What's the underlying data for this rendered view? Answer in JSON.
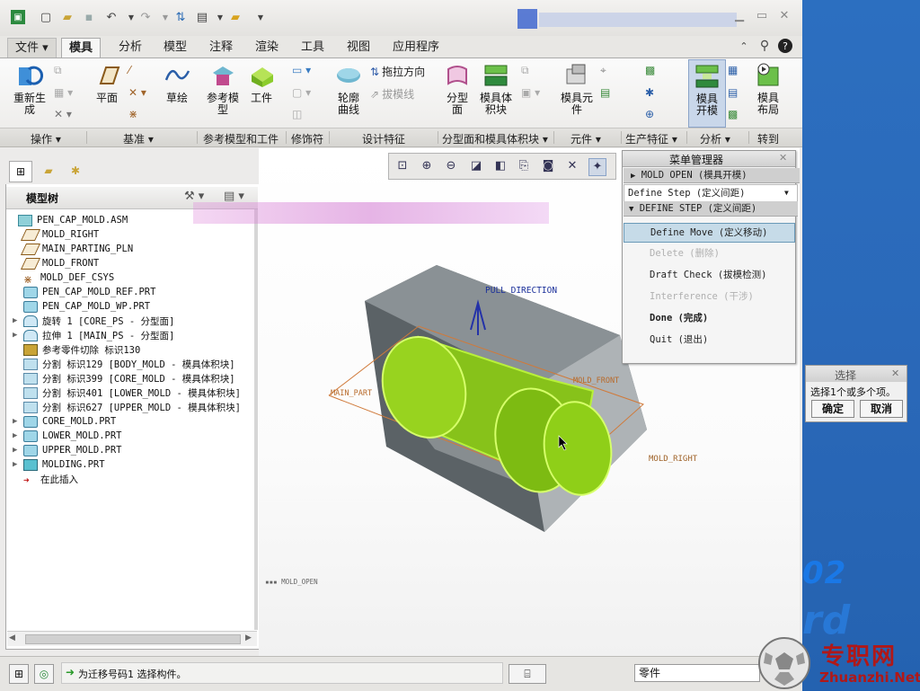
{
  "colors": {
    "accent": "#9bd70f",
    "desktop": "#2a68b8",
    "tab_active_bg": "#f6f6f5"
  },
  "ribbon_tabs": [
    "文件",
    "模具",
    "分析",
    "模型",
    "注释",
    "渲染",
    "工具",
    "视图",
    "应用程序"
  ],
  "ribbon": {
    "regenerate": "重新生\n成",
    "plane": "平面",
    "sketch": "草绘",
    "ref_model": "参考模\n型",
    "workpiece": "工件",
    "profile_curve": "轮廓\n曲线",
    "drag_direction": "拖拉方向",
    "draft_line": "拔模线",
    "parting_surface": "分型\n面",
    "mold_volume": "模具体\n积块",
    "mold_component": "模具元\n件",
    "mold_open": "模具\n开模",
    "mold_layout": "模具\n布局"
  },
  "groups": [
    "操作",
    "基准",
    "参考模型和工件",
    "修饰符",
    "设计特征",
    "分型面和模具体积块",
    "元件",
    "生产特征",
    "分析",
    "转到"
  ],
  "tree": {
    "title": "模型树",
    "items": [
      {
        "label": "PEN_CAP_MOLD.ASM",
        "icon": "assembly-icon",
        "expand": ""
      },
      {
        "label": "MOLD_RIGHT",
        "icon": "datum-plane-icon",
        "expand": ""
      },
      {
        "label": "MAIN_PARTING_PLN",
        "icon": "datum-plane-icon",
        "expand": ""
      },
      {
        "label": "MOLD_FRONT",
        "icon": "datum-plane-icon",
        "expand": ""
      },
      {
        "label": "MOLD_DEF_CSYS",
        "icon": "csys-icon",
        "expand": ""
      },
      {
        "label": "PEN_CAP_MOLD_REF.PRT",
        "icon": "part-icon",
        "expand": ""
      },
      {
        "label": "PEN_CAP_MOLD_WP.PRT",
        "icon": "part-icon",
        "expand": ""
      },
      {
        "label": "旋转 1 [CORE_PS - 分型面]",
        "icon": "surface-icon",
        "expand": "▶"
      },
      {
        "label": "拉伸 1 [MAIN_PS - 分型面]",
        "icon": "surface-icon",
        "expand": "▶"
      },
      {
        "label": "参考零件切除 标识130",
        "icon": "cut-icon",
        "expand": ""
      },
      {
        "label": "分割 标识129 [BODY_MOLD - 模具体积块]",
        "icon": "split-icon",
        "expand": ""
      },
      {
        "label": "分割 标识399 [CORE_MOLD - 模具体积块]",
        "icon": "split-icon",
        "expand": ""
      },
      {
        "label": "分割 标识401 [LOWER_MOLD - 模具体积块]",
        "icon": "split-icon",
        "expand": ""
      },
      {
        "label": "分割 标识627 [UPPER_MOLD - 模具体积块]",
        "icon": "split-icon",
        "expand": ""
      },
      {
        "label": "CORE_MOLD.PRT",
        "icon": "part-icon",
        "expand": "▶"
      },
      {
        "label": "LOWER_MOLD.PRT",
        "icon": "part-icon",
        "expand": "▶"
      },
      {
        "label": "UPPER_MOLD.PRT",
        "icon": "part-icon",
        "expand": "▶"
      },
      {
        "label": "MOLDING.PRT",
        "icon": "molding-icon",
        "expand": "▶"
      },
      {
        "label": "在此插入",
        "icon": "insert-arrow-icon",
        "expand": ""
      }
    ]
  },
  "graphics": {
    "pull_direction": "PULL DIRECTION",
    "main_part": "MAIN_PART",
    "mold_front": "MOLD_FRONT",
    "mold_right": "MOLD_RIGHT",
    "view_name": "MOLD_OPEN"
  },
  "menu_manager": {
    "title": "菜单管理器",
    "mold_open": "MOLD OPEN (模具开模)",
    "define_step": "Define Step (定义间距)",
    "define_step_header": "DEFINE STEP (定义间距)",
    "items": [
      {
        "label": "Define Move (定义移动)",
        "state": "selected"
      },
      {
        "label": "Delete (删除)",
        "state": "disabled"
      },
      {
        "label": "Draft Check (拔模检测)",
        "state": "normal"
      },
      {
        "label": "Interference (干涉)",
        "state": "disabled"
      },
      {
        "label": "Done (完成)",
        "state": "bold"
      },
      {
        "label": "Quit (退出)",
        "state": "normal"
      }
    ]
  },
  "select_dialog": {
    "title": "选择",
    "prompt": "选择1个或多个项。",
    "ok": "确定",
    "cancel": "取消"
  },
  "status": {
    "message": "为迁移号码1 选择构件。",
    "filter": "零件"
  },
  "watermark": {
    "cn": "专职网",
    "en": "Zhuanzhi.Net"
  }
}
